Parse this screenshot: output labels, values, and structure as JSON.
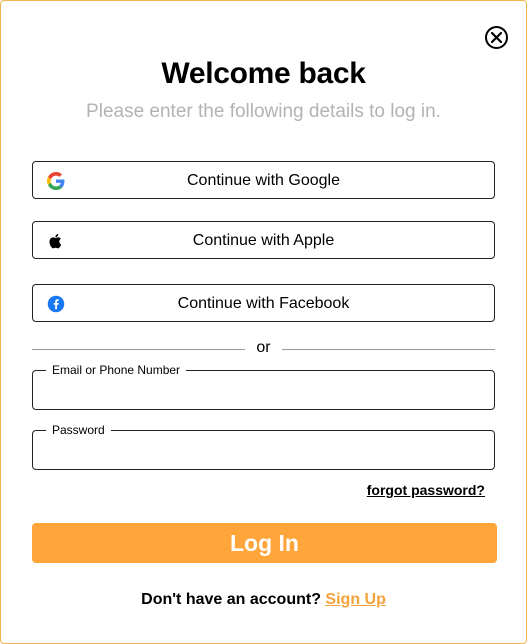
{
  "dialog": {
    "title": "Welcome back",
    "subtitle": "Please enter the following details to log in."
  },
  "social": [
    {
      "label": "Continue with Google",
      "icon": "google-icon"
    },
    {
      "label": "Continue with Apple",
      "icon": "apple-icon"
    },
    {
      "label": "Continue with Facebook",
      "icon": "facebook-icon"
    }
  ],
  "divider": {
    "text": "or"
  },
  "form": {
    "email_label": "Email or Phone Number",
    "email_value": "",
    "password_label": "Password",
    "password_value": ""
  },
  "links": {
    "forgot": "forgot password?",
    "login": "Log In",
    "no_account": "Don't have an account?",
    "signup": "Sign Up"
  },
  "colors": {
    "accent": "#ffa53a",
    "border": "#f3b552",
    "subtitle": "#b3b3b3",
    "facebook": "#1877f2"
  }
}
